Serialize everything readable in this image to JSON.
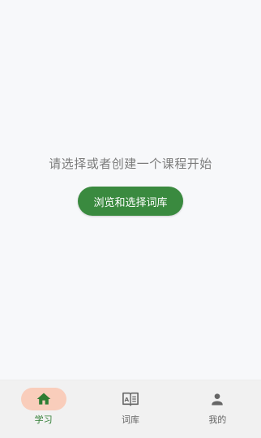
{
  "main": {
    "empty_message": "请选择或者创建一个课程开始",
    "browse_button_label": "浏览和选择词库"
  },
  "bottom_nav": {
    "items": [
      {
        "label": "学习",
        "icon": "home-icon",
        "active": true
      },
      {
        "label": "词库",
        "icon": "book-icon",
        "active": false
      },
      {
        "label": "我的",
        "icon": "person-icon",
        "active": false
      }
    ]
  },
  "colors": {
    "primary": "#3a8a3f",
    "active_pill": "#f9cdbb",
    "active_label": "#2f7d33",
    "inactive_icon": "#666666",
    "background": "#f7f8fa"
  }
}
